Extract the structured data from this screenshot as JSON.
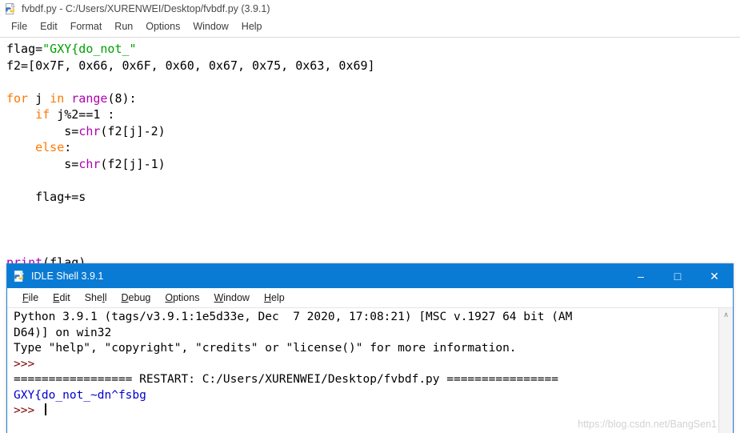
{
  "editor": {
    "icon": "python-file-icon",
    "title": "fvbdf.py - C:/Users/XURENWEI/Desktop/fvbdf.py (3.9.1)",
    "menus": [
      {
        "label": "File"
      },
      {
        "label": "Edit"
      },
      {
        "label": "Format"
      },
      {
        "label": "Run"
      },
      {
        "label": "Options"
      },
      {
        "label": "Window"
      },
      {
        "label": "Help"
      }
    ],
    "code_lines": [
      [
        {
          "t": "flag=",
          "c": "plain"
        },
        {
          "t": "\"GXY{do_not_\"",
          "c": "string"
        }
      ],
      [
        {
          "t": "f2=[0x7F, 0x66, 0x6F, 0x60, 0x67, 0x75, 0x63, 0x69]",
          "c": "plain"
        }
      ],
      [],
      [
        {
          "t": "for",
          "c": "keyword"
        },
        {
          "t": " j ",
          "c": "plain"
        },
        {
          "t": "in",
          "c": "keyword"
        },
        {
          "t": " ",
          "c": "plain"
        },
        {
          "t": "range",
          "c": "builtin"
        },
        {
          "t": "(8):",
          "c": "plain"
        }
      ],
      [
        {
          "t": "    ",
          "c": "plain"
        },
        {
          "t": "if",
          "c": "keyword"
        },
        {
          "t": " j%2==1 :",
          "c": "plain"
        }
      ],
      [
        {
          "t": "        s=",
          "c": "plain"
        },
        {
          "t": "chr",
          "c": "builtin"
        },
        {
          "t": "(f2[j]-2)",
          "c": "plain"
        }
      ],
      [
        {
          "t": "    ",
          "c": "plain"
        },
        {
          "t": "else",
          "c": "keyword"
        },
        {
          "t": ":",
          "c": "plain"
        }
      ],
      [
        {
          "t": "        s=",
          "c": "plain"
        },
        {
          "t": "chr",
          "c": "builtin"
        },
        {
          "t": "(f2[j]-1)",
          "c": "plain"
        }
      ],
      [],
      [
        {
          "t": "    flag+=s",
          "c": "plain"
        }
      ],
      [],
      [],
      [],
      [
        {
          "t": "print",
          "c": "builtin"
        },
        {
          "t": "(flag)",
          "c": "plain"
        }
      ]
    ]
  },
  "shell": {
    "icon": "python-shell-icon",
    "title": "IDLE Shell 3.9.1",
    "window_buttons": [
      {
        "name": "minimize",
        "glyph": "–"
      },
      {
        "name": "maximize",
        "glyph": "□"
      },
      {
        "name": "close",
        "glyph": "✕"
      }
    ],
    "menus": [
      {
        "mnemonic": "F",
        "rest": "ile"
      },
      {
        "mnemonic": "E",
        "rest": "dit"
      },
      {
        "pre": "She",
        "mnemonic": "l",
        "rest": "l"
      },
      {
        "mnemonic": "D",
        "rest": "ebug"
      },
      {
        "mnemonic": "O",
        "rest": "ptions"
      },
      {
        "mnemonic": "W",
        "rest": "indow"
      },
      {
        "mnemonic": "H",
        "rest": "elp"
      }
    ],
    "output_lines": [
      [
        {
          "t": "Python 3.9.1 (tags/v3.9.1:1e5d33e, Dec  7 2020, 17:08:21) [MSC v.1927 64 bit (AM",
          "c": "plain"
        }
      ],
      [
        {
          "t": "D64)] on win32",
          "c": "plain"
        }
      ],
      [
        {
          "t": "Type \"help\", \"copyright\", \"credits\" or \"license()\" for more information.",
          "c": "plain"
        }
      ],
      [
        {
          "t": ">>>",
          "c": "prompt"
        }
      ],
      [
        {
          "t": "================= RESTART: C:/Users/XURENWEI/Desktop/fvbdf.py ================",
          "c": "plain"
        }
      ],
      [
        {
          "t": "GXY{do_not_~dn^fsbg",
          "c": "output"
        }
      ],
      [
        {
          "t": ">>> ",
          "c": "prompt"
        },
        {
          "t": "",
          "c": "cursor"
        }
      ]
    ],
    "scrollbar": {
      "up_arrow": "∧"
    }
  },
  "watermark": {
    "text": "https://blog.csdn.net/BangSen1"
  },
  "colors": {
    "titlebar_blue": "#0a7bd4",
    "keyword_orange": "#ff7700",
    "builtin_purple": "#b000b0",
    "string_green": "#00a000",
    "prompt_maroon": "#7f0000",
    "output_blue": "#0000cc"
  }
}
